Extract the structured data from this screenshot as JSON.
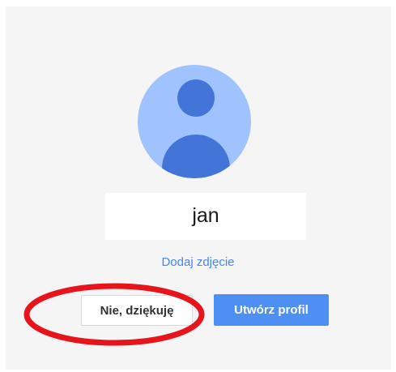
{
  "profile": {
    "name": "jan",
    "add_photo_label": "Dodaj zdjęcie"
  },
  "buttons": {
    "decline_label": "Nie, dziękuję",
    "create_label": "Utwórz profil"
  },
  "colors": {
    "avatar_background": "#a0c3ff",
    "avatar_silhouette": "#4375d9",
    "link": "#4285f4",
    "primary_button": "#4d8ff2",
    "highlight": "#e8141c"
  },
  "icons": {
    "avatar": "user-silhouette-icon"
  }
}
